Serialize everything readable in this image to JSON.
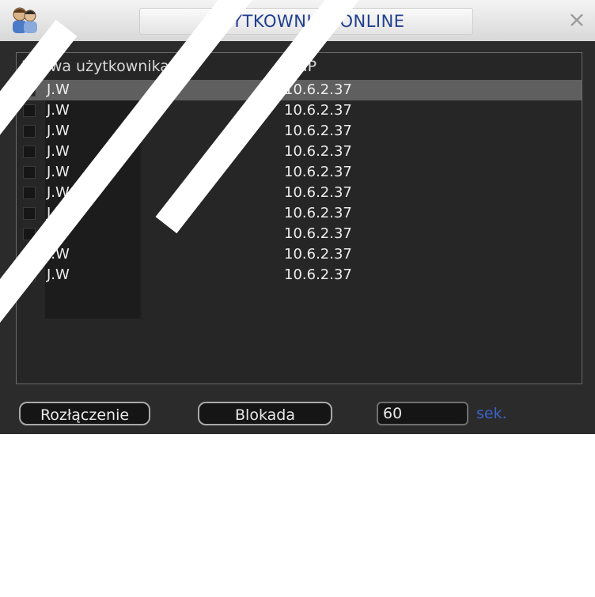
{
  "dialog": {
    "title": "UŻYTKOWNICY ONLINE",
    "close_label": "×"
  },
  "table": {
    "columns": [
      "Nazwa użytkownika",
      "IP"
    ],
    "rows": [
      {
        "name": "J.W",
        "ip": "10.6.2.37",
        "selected": true
      },
      {
        "name": "J.W",
        "ip": "10.6.2.37"
      },
      {
        "name": "J.W",
        "ip": "10.6.2.37"
      },
      {
        "name": "J.W",
        "ip": "10.6.2.37"
      },
      {
        "name": "J.W",
        "ip": "10.6.2.37"
      },
      {
        "name": "J.W",
        "ip": "10.6.2.37"
      },
      {
        "name": "J.W",
        "ip": "10.6.2.37"
      },
      {
        "name": "J.W",
        "ip": "10.6.2.37"
      },
      {
        "name": "J.W",
        "ip": "10.6.2.37"
      },
      {
        "name": "J.W",
        "ip": "10.6.2.37"
      }
    ]
  },
  "footer": {
    "disconnect_label": "Rozłączenie",
    "block_label": "Blokada",
    "seconds_value": "60",
    "seconds_unit": "sek."
  },
  "colors": {
    "title_text": "#1f3f8f",
    "unit_text": "#3b63c8",
    "panel_bg": "#262626",
    "selected_row": "#5f5f5f"
  },
  "icons": {
    "title_icon": "users-icon",
    "close_icon": "close-icon"
  }
}
